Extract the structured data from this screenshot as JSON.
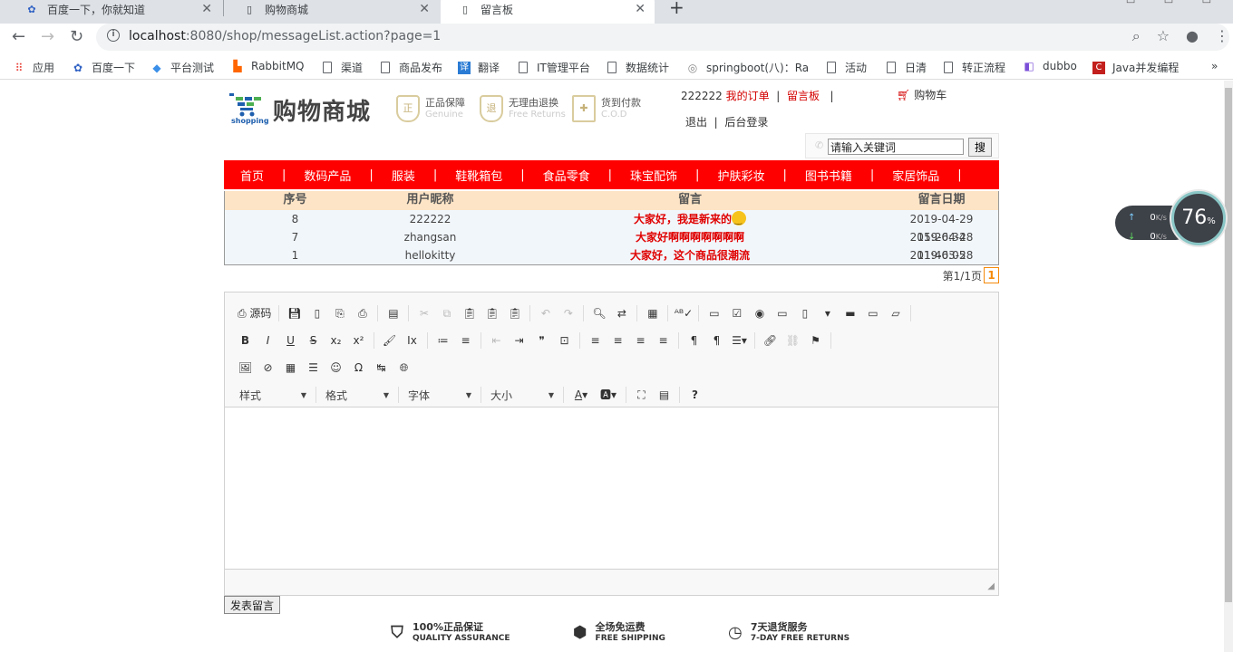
{
  "browser": {
    "tabs": [
      {
        "title": "百度一下，你就知道",
        "icon": "paw-icon"
      },
      {
        "title": "购物商城",
        "icon": "page-icon"
      },
      {
        "title": "留言板",
        "icon": "page-icon"
      }
    ],
    "url_host": "localhost",
    "url_rest": ":8080/shop/messageList.action?page=1",
    "bookmarks": [
      "应用",
      "百度一下",
      "平台测试",
      "RabbitMQ",
      "渠道",
      "商品发布",
      "翻译",
      "IT管理平台",
      "数据统计",
      "springboot(八)：Ra",
      "活动",
      "日清",
      "转正流程",
      "dubbo",
      "Java并发编程"
    ]
  },
  "header": {
    "logo_text": "购物商城",
    "logo_sub": "shopping",
    "assurances": [
      {
        "cn": "正品保障",
        "en": "Genuine"
      },
      {
        "cn": "无理由退换",
        "en": "Free Returns"
      },
      {
        "cn": "货到付款",
        "en": "C.O.D"
      }
    ],
    "username": "222222",
    "my_orders": "我的订单",
    "message_board": "留言板",
    "sep": "|",
    "cart": "购物车",
    "logout": "退出",
    "admin_login": "后台登录",
    "search_value": "请输入关键词",
    "search_button": "搜"
  },
  "nav": [
    "首页",
    "数码产品",
    "服装",
    "鞋靴箱包",
    "食品零食",
    "珠宝配饰",
    "护肤彩妆",
    "图书书籍",
    "家居饰品"
  ],
  "nav_sep": "|",
  "messages": {
    "headers": [
      "序号",
      "用户昵称",
      "留言",
      "留言日期"
    ],
    "rows": [
      {
        "id": "8",
        "user": "222222",
        "text": "大家好，我是新来的",
        "date": "2019-04-29 15:26:34",
        "emoji": true
      },
      {
        "id": "7",
        "user": "zhangsan",
        "text": "大家好啊啊啊啊啊啊啊",
        "date": "2019-04-28 11:46:05",
        "emoji": false
      },
      {
        "id": "1",
        "user": "hellokitty",
        "text": "大家好，这个商品很潮流",
        "date": "2019-03-28",
        "emoji": false
      }
    ]
  },
  "pager": {
    "label": "第1/1页",
    "current": "1"
  },
  "editor": {
    "source_label": "源码",
    "combos": [
      "样式",
      "格式",
      "字体",
      "大小"
    ]
  },
  "submit_label": "发表留言",
  "footer": [
    {
      "cn": "100%正品保证",
      "en": "QUALITY ASSURANCE"
    },
    {
      "cn": "全场免运费",
      "en": "FREE SHIPPING"
    },
    {
      "cn": "7天退货服务",
      "en": "7-DAY FREE RETURNS"
    }
  ],
  "netspeed": {
    "up": "0",
    "down": "0",
    "unit": "K/s",
    "percent": "76",
    "percent_sign": "%"
  },
  "colors": {
    "nav_red": "#ff0000",
    "accent_red": "#d40000",
    "table_header": "#fde4c6"
  }
}
